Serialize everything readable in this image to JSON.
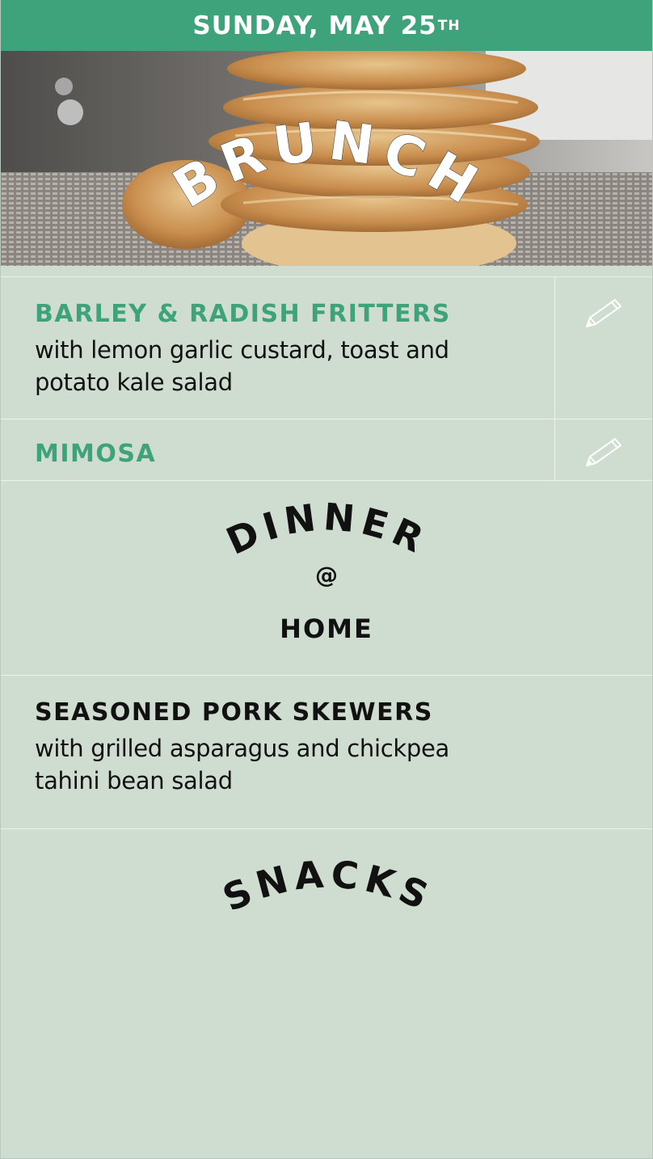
{
  "header": {
    "date_main": "SUNDAY, MAY 25",
    "date_suffix": "TH"
  },
  "brunch": {
    "title": "BRUNCH",
    "items": [
      {
        "name": "BARLEY & RADISH FRITTERS",
        "desc_line1": "with lemon garlic custard, toast and",
        "desc_line2": "potato kale salad",
        "edit_icon": "pencil-icon"
      },
      {
        "name": "MIMOSA",
        "edit_icon": "pencil-icon"
      }
    ]
  },
  "dinner": {
    "title": "DINNER",
    "at": "@",
    "location": "HOME",
    "items": [
      {
        "name": "SEASONED PORK SKEWERS",
        "desc_line1": "with grilled asparagus and chickpea",
        "desc_line2": "tahini bean salad"
      }
    ]
  },
  "snacks": {
    "title": "SNACKS"
  },
  "colors": {
    "accent": "#3ea37a",
    "background": "#cfdcd0",
    "text": "#111111"
  }
}
